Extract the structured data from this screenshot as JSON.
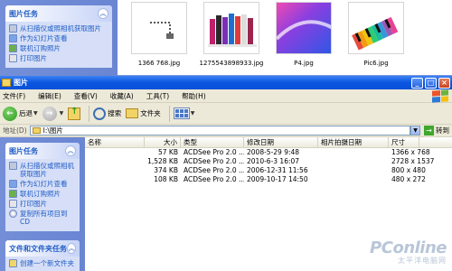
{
  "bg_window": {
    "task_panel": {
      "title": "图片任务",
      "items": [
        {
          "label": "从扫描仪或照相机获取图片",
          "icon": "camera-icon"
        },
        {
          "label": "作为幻灯片查看",
          "icon": "slideshow-icon"
        },
        {
          "label": "联机订购照片",
          "icon": "web-order-icon"
        },
        {
          "label": "打印图片",
          "icon": "print-icon"
        }
      ]
    },
    "thumbnails": [
      {
        "caption": "1366 768.jpg"
      },
      {
        "caption": "1275543898933.jpg"
      },
      {
        "caption": "P4.jpg"
      },
      {
        "caption": "Pic6.jpg"
      }
    ]
  },
  "window": {
    "title": "图片",
    "controls": {
      "minimize": "_",
      "maximize": "□",
      "close": "×"
    }
  },
  "menu": [
    "文件(F)",
    "编辑(E)",
    "查看(V)",
    "收藏(A)",
    "工具(T)",
    "帮助(H)"
  ],
  "toolbar": {
    "back": "后退",
    "search": "搜索",
    "folders": "文件夹"
  },
  "address": {
    "label": "地址(D)",
    "value": "I:\\图片",
    "go": "转到"
  },
  "task_panel": {
    "picture_tasks": {
      "title": "图片任务",
      "items": [
        {
          "label": "从扫描仪或照相机获取图片",
          "icon": "camera-icon"
        },
        {
          "label": "作为幻灯片查看",
          "icon": "slideshow-icon"
        },
        {
          "label": "联机订购照片",
          "icon": "web-order-icon"
        },
        {
          "label": "打印图片",
          "icon": "print-icon"
        },
        {
          "label": "复制所有项目到 CD",
          "icon": "cd-icon"
        }
      ]
    },
    "file_tasks": {
      "title": "文件和文件夹任务",
      "items": [
        {
          "label": "创建一个新文件夹",
          "icon": "new-folder-icon"
        }
      ]
    }
  },
  "file_list": {
    "columns": [
      "名称",
      "大小",
      "类型",
      "修改日期",
      "相片拍摄日期",
      "尺寸"
    ],
    "rows": [
      {
        "size": "57 KB",
        "type": "ACDSee Pro 2.0 ...",
        "modified": "2008-5-29 9:48",
        "taken": "",
        "dims": "1366 x 768"
      },
      {
        "size": "1,528 KB",
        "type": "ACDSee Pro 2.0 ...",
        "modified": "2010-6-3 16:07",
        "taken": "",
        "dims": "2728 x 1537"
      },
      {
        "size": "374 KB",
        "type": "ACDSee Pro 2.0 ...",
        "modified": "2006-12-31 11:56",
        "taken": "",
        "dims": "800 x 480"
      },
      {
        "size": "108 KB",
        "type": "ACDSee Pro 2.0 ...",
        "modified": "2009-10-17 14:50",
        "taken": "",
        "dims": "480 x 272"
      }
    ]
  },
  "watermark": {
    "brand": "PConline",
    "sub": "太平洋电脑网"
  }
}
